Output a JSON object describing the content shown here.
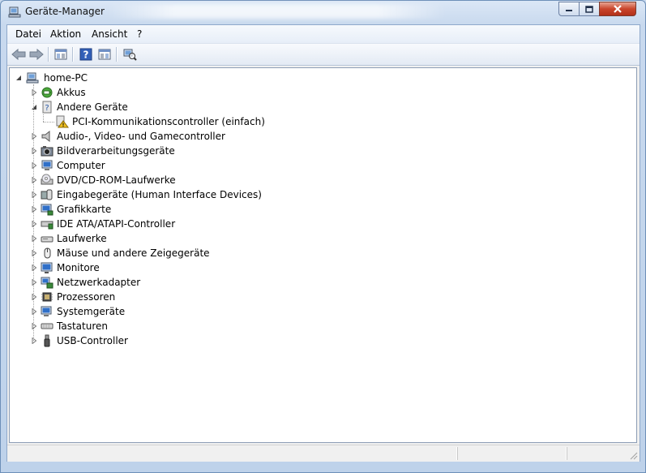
{
  "window": {
    "title": "Geräte-Manager",
    "controls": {
      "minimize": "minimize",
      "maximize": "maximize",
      "close": "close"
    }
  },
  "menu": [
    "Datei",
    "Aktion",
    "Ansicht",
    "?"
  ],
  "toolbar": {
    "buttons": [
      "back-icon",
      "forward-icon",
      "show-hide-console-tree-icon",
      "help-icon",
      "properties-icon",
      "scan-hardware-icon"
    ]
  },
  "tree": {
    "root": {
      "label": "home-PC",
      "expanded": true
    },
    "items": [
      {
        "label": "Akkus",
        "expanded": false,
        "icon": "battery-icon"
      },
      {
        "label": "Andere Geräte",
        "expanded": true,
        "icon": "unknown-device-icon",
        "children": [
          {
            "label": "PCI-Kommunikationscontroller (einfach)",
            "icon": "warning-device-icon"
          }
        ]
      },
      {
        "label": "Audio-, Video- und Gamecontroller",
        "expanded": false,
        "icon": "speaker-icon"
      },
      {
        "label": "Bildverarbeitungsgeräte",
        "expanded": false,
        "icon": "camera-icon"
      },
      {
        "label": "Computer",
        "expanded": false,
        "icon": "computer-icon"
      },
      {
        "label": "DVD/CD-ROM-Laufwerke",
        "expanded": false,
        "icon": "dvd-drive-icon"
      },
      {
        "label": "Eingabegeräte (Human Interface Devices)",
        "expanded": false,
        "icon": "hid-icon"
      },
      {
        "label": "Grafikkarte",
        "expanded": false,
        "icon": "display-adapter-icon"
      },
      {
        "label": "IDE ATA/ATAPI-Controller",
        "expanded": false,
        "icon": "ide-controller-icon"
      },
      {
        "label": "Laufwerke",
        "expanded": false,
        "icon": "disk-drive-icon"
      },
      {
        "label": "Mäuse und andere Zeigegeräte",
        "expanded": false,
        "icon": "mouse-icon"
      },
      {
        "label": "Monitore",
        "expanded": false,
        "icon": "monitor-icon"
      },
      {
        "label": "Netzwerkadapter",
        "expanded": false,
        "icon": "network-adapter-icon"
      },
      {
        "label": "Prozessoren",
        "expanded": false,
        "icon": "processor-icon"
      },
      {
        "label": "Systemgeräte",
        "expanded": false,
        "icon": "system-devices-icon"
      },
      {
        "label": "Tastaturen",
        "expanded": false,
        "icon": "keyboard-icon"
      },
      {
        "label": "USB-Controller",
        "expanded": false,
        "icon": "usb-icon"
      }
    ]
  },
  "colors": {
    "selection": "#cce8ff",
    "titlebar": "#c8d9ee",
    "warning": "#f0c020"
  }
}
